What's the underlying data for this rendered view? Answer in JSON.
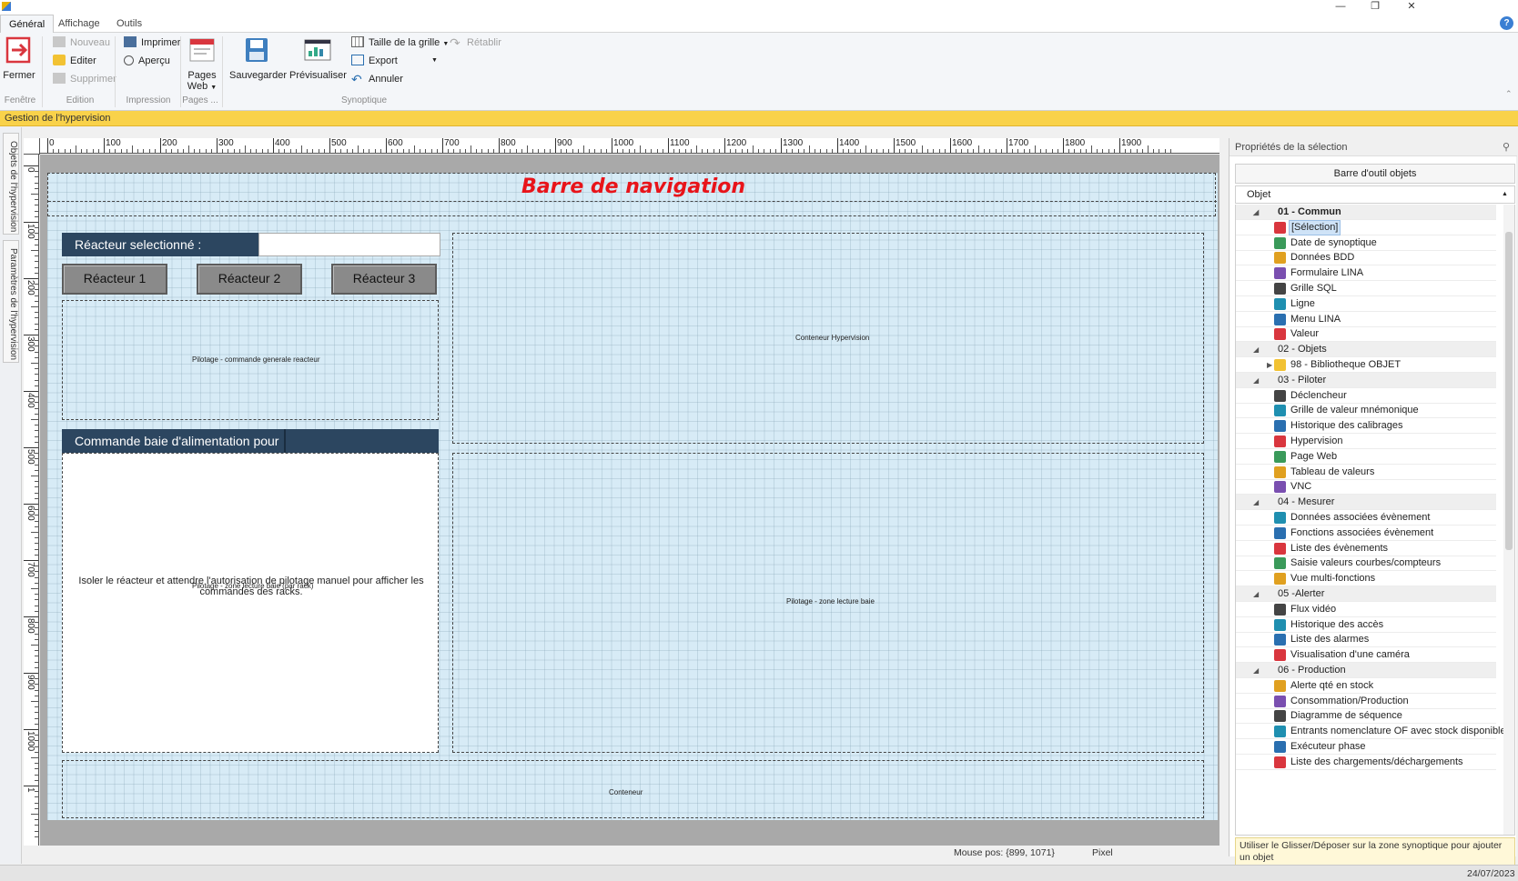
{
  "ribbon": {
    "tabs": [
      "Général",
      "Affichage",
      "Outils"
    ],
    "fenetre": {
      "fermer": "Fermer",
      "group": "Fenêtre"
    },
    "edition": {
      "nouveau": "Nouveau",
      "editer": "Editer",
      "supprimer": "Supprimer",
      "group": "Edition"
    },
    "impression": {
      "imprimer": "Imprimer",
      "apercu": "Aperçu",
      "group": "Impression"
    },
    "pages": {
      "pages_web_1": "Pages",
      "pages_web_2": "Web",
      "group": "Pages ..."
    },
    "synoptique": {
      "sauvegarder": "Sauvegarder",
      "previsualiser": "Prévisualiser",
      "taille_grille": "Taille de la grille",
      "export": "Export",
      "annuler": "Annuler",
      "retablir": "Rétablir",
      "group": "Synoptique"
    }
  },
  "banner": "Gestion de l'hypervision",
  "vtabs": [
    "Objets de l'hypervision",
    "Paramètres de l'hypervision"
  ],
  "ruler": {
    "top": [
      "0",
      "100",
      "200",
      "300",
      "400",
      "500",
      "600",
      "700",
      "800",
      "900",
      "1000",
      "1100",
      "1200",
      "1300",
      "1400",
      "1500",
      "1600",
      "1700",
      "1800",
      "1900"
    ],
    "left": [
      "0",
      "100",
      "200",
      "300",
      "400",
      "500",
      "600",
      "700",
      "800",
      "900",
      "1000",
      "1"
    ]
  },
  "canvas": {
    "nav_title": "Barre de navigation",
    "reacteur_label": "Réacteur selectionné :",
    "reactors": [
      "Réacteur 1",
      "Réacteur 2",
      "Réacteur 3"
    ],
    "pilotage_cmd": "Pilotage - commande generale reacteur",
    "conteneur_hyper": "Conteneur Hypervision",
    "commande_baie": "Commande baie d'alimentation pour",
    "isoler_text": "Isoler le réacteur et attendre l'autorisation de pilotage manuel pour afficher les commandes des racks.",
    "pilotage_lecture_rack": "Pilotage - zone lecture baie (par rack)",
    "pilotage_lecture_baie": "Pilotage - zone lecture baie",
    "conteneur": "Conteneur"
  },
  "rpanel": {
    "title": "Propriétés de la sélection",
    "toolbar_title": "Barre d'outil objets",
    "col_header": "Objet",
    "items": [
      {
        "t": "01 - Commun",
        "cat": true,
        "bold": true
      },
      {
        "t": "[Sélection]",
        "sel": true,
        "icon": "cursor-icon"
      },
      {
        "t": "Date de synoptique",
        "icon": "calendar-icon"
      },
      {
        "t": "Données BDD",
        "icon": "database-icon"
      },
      {
        "t": "Formulaire LINA",
        "icon": "form-icon"
      },
      {
        "t": "Grille SQL",
        "icon": "grid-icon"
      },
      {
        "t": "Ligne",
        "icon": "line-icon"
      },
      {
        "t": "Menu LINA",
        "icon": "menu-icon"
      },
      {
        "t": "Valeur",
        "icon": "value-icon"
      },
      {
        "t": "02 - Objets",
        "cat": true
      },
      {
        "t": "98 - Bibliotheque OBJET",
        "icon": "folder-icon",
        "sub": true
      },
      {
        "t": "03 - Piloter",
        "cat": true
      },
      {
        "t": "Déclencheur",
        "icon": "lightning-icon"
      },
      {
        "t": "Grille de valeur mnémonique",
        "icon": "mnemonic-icon"
      },
      {
        "t": "Historique des calibrages",
        "icon": "calibration-icon"
      },
      {
        "t": "Hypervision",
        "icon": "hypervision-icon"
      },
      {
        "t": "Page Web",
        "icon": "browser-icon"
      },
      {
        "t": "Tableau de valeurs",
        "icon": "table-icon"
      },
      {
        "t": "VNC",
        "icon": "vnc-icon"
      },
      {
        "t": "04 - Mesurer",
        "cat": true
      },
      {
        "t": "Données associées évènement",
        "icon": "event-data-icon"
      },
      {
        "t": "Fonctions associées évènement",
        "icon": "event-func-icon"
      },
      {
        "t": "Liste des évènements",
        "icon": "event-list-icon"
      },
      {
        "t": "Saisie valeurs courbes/compteurs",
        "icon": "plus-circle-icon"
      },
      {
        "t": "Vue multi-fonctions",
        "icon": "chart-icon"
      },
      {
        "t": "05 -Alerter",
        "cat": true
      },
      {
        "t": "Flux vidéo",
        "icon": "video-icon"
      },
      {
        "t": "Historique des accès",
        "icon": "access-icon"
      },
      {
        "t": "Liste des alarmes",
        "icon": "alarm-icon"
      },
      {
        "t": "Visualisation d'une caméra",
        "icon": "camera-icon"
      },
      {
        "t": "06 - Production",
        "cat": true
      },
      {
        "t": "Alerte qté en stock",
        "icon": "stock-icon"
      },
      {
        "t": "Consommation/Production",
        "icon": "consumption-icon"
      },
      {
        "t": "Diagramme de séquence",
        "icon": "sequence-icon"
      },
      {
        "t": "Entrants nomenclature OF avec stock disponible",
        "icon": "nomenclature-icon"
      },
      {
        "t": "Exécuteur phase",
        "icon": "phase-icon"
      },
      {
        "t": "Liste des chargements/déchargements",
        "icon": "loading-icon"
      }
    ],
    "hint": "Utiliser le Glisser/Déposer sur la zone synoptique pour ajouter un objet"
  },
  "status": {
    "mouse": "Mouse pos: {899, 1071}",
    "unit": "Pixel",
    "date": "24/07/2023"
  }
}
